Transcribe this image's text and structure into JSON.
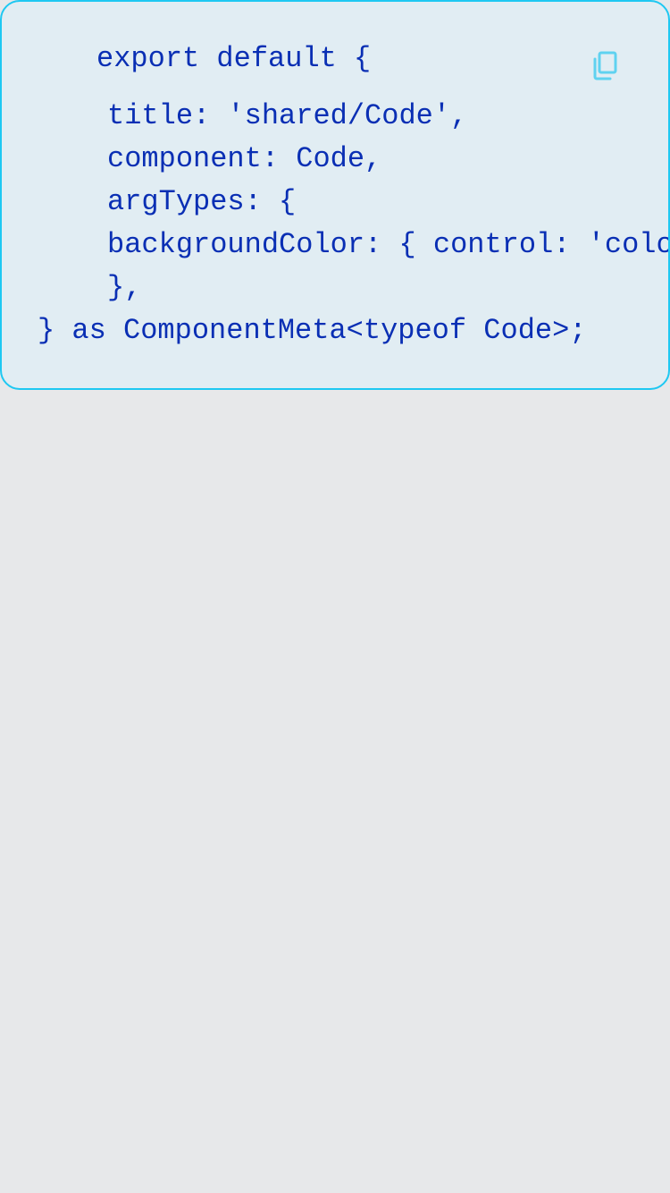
{
  "code_block": {
    "lines": [
      "export default {",
      "title: 'shared/Code',",
      "component: Code,",
      "argTypes: {",
      "backgroundColor: { control: 'color' },",
      "},",
      "} as ComponentMeta<typeof Code>;"
    ],
    "copy_icon": "copy-icon"
  },
  "colors": {
    "page_background": "#e7e8ea",
    "card_background": "#e1edf3",
    "card_border": "#1ec8f2",
    "code_text": "#0a2fb4",
    "copy_icon": "#5fd2f0"
  }
}
